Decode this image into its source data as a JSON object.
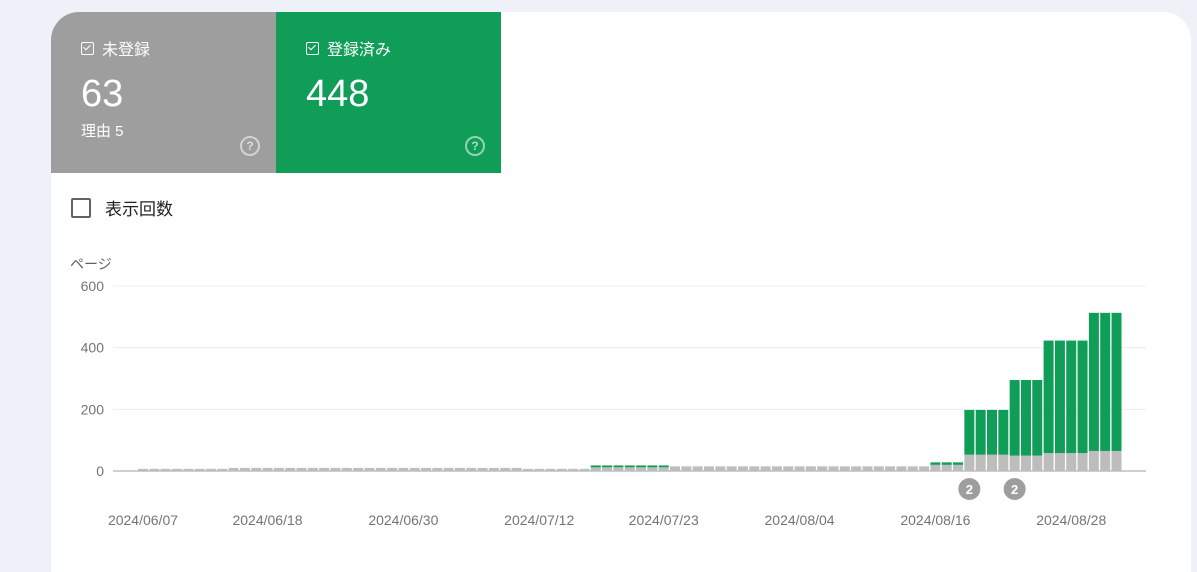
{
  "tiles": {
    "unregistered": {
      "label": "未登録",
      "value": "63",
      "sub": "理由 5",
      "color": "#9e9e9e",
      "help_icon": "help-circle-icon"
    },
    "registered": {
      "label": "登録済み",
      "value": "448",
      "color": "#0f9d58",
      "help_icon": "help-circle-icon"
    }
  },
  "impressions_toggle": {
    "label": "表示回数",
    "checked": false
  },
  "chart_data": {
    "type": "bar",
    "stacked": true,
    "y_title": "ページ",
    "ylim": [
      0,
      600
    ],
    "y_ticks": [
      "0",
      "200",
      "400",
      "600"
    ],
    "x_tick_labels": [
      "2024/06/07",
      "2024/06/18",
      "2024/06/30",
      "2024/07/12",
      "2024/07/23",
      "2024/08/04",
      "2024/08/16",
      "2024/08/28"
    ],
    "x_tick_indices": [
      0,
      11,
      23,
      35,
      46,
      58,
      70,
      82
    ],
    "grid": true,
    "series": [
      {
        "name": "未登録",
        "color": "#bdbdbd",
        "values": [
          7,
          7,
          7,
          7,
          7,
          7,
          7,
          7,
          10,
          10,
          10,
          10,
          10,
          10,
          10,
          10,
          10,
          10,
          10,
          10,
          10,
          10,
          10,
          10,
          10,
          10,
          10,
          10,
          10,
          10,
          10,
          10,
          10,
          10,
          7,
          7,
          7,
          7,
          7,
          7,
          12,
          12,
          12,
          12,
          12,
          12,
          12,
          15,
          15,
          15,
          15,
          15,
          15,
          15,
          15,
          15,
          15,
          15,
          15,
          15,
          15,
          15,
          15,
          15,
          15,
          15,
          15,
          15,
          15,
          15,
          20,
          20,
          20,
          53,
          53,
          53,
          53,
          50,
          50,
          50,
          58,
          58,
          58,
          58,
          65,
          65,
          65
        ]
      },
      {
        "name": "登録済み",
        "color": "#0f9d58",
        "values": [
          0,
          0,
          0,
          0,
          0,
          0,
          0,
          0,
          0,
          0,
          0,
          0,
          0,
          0,
          0,
          0,
          0,
          0,
          0,
          0,
          0,
          0,
          0,
          0,
          0,
          0,
          0,
          0,
          0,
          0,
          0,
          0,
          0,
          0,
          0,
          0,
          0,
          0,
          0,
          0,
          6,
          6,
          6,
          6,
          6,
          6,
          6,
          0,
          0,
          0,
          0,
          0,
          0,
          0,
          0,
          0,
          0,
          0,
          0,
          0,
          0,
          0,
          0,
          0,
          0,
          0,
          0,
          0,
          0,
          0,
          8,
          8,
          8,
          145,
          145,
          145,
          145,
          245,
          245,
          245,
          365,
          365,
          365,
          365,
          448,
          448,
          448
        ]
      }
    ],
    "annotations": [
      {
        "index": 73,
        "label": "2"
      },
      {
        "index": 77,
        "label": "2"
      }
    ]
  }
}
